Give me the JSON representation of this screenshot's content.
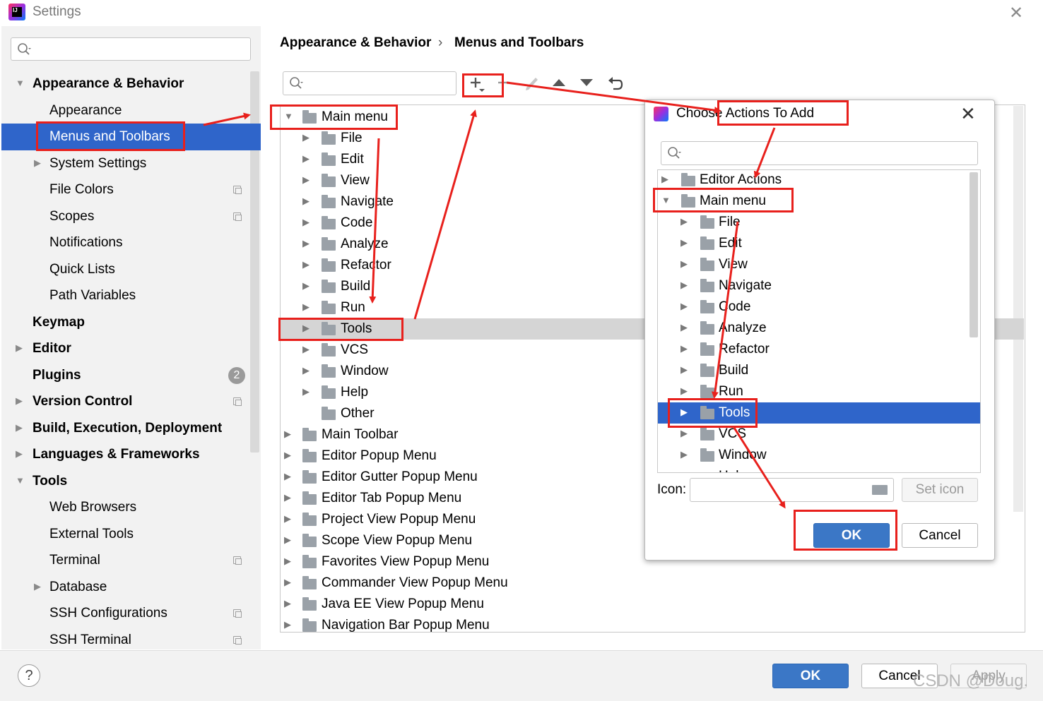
{
  "window": {
    "title": "Settings",
    "close_glyph": "✕",
    "logo_text": "IJ"
  },
  "breadcrumb": {
    "parent": "Appearance & Behavior",
    "separator": "›",
    "current": "Menus and Toolbars"
  },
  "sidebar": {
    "search_placeholder": "",
    "items": [
      {
        "label": "Appearance & Behavior"
      },
      {
        "label": "Appearance"
      },
      {
        "label": "Menus and Toolbars"
      },
      {
        "label": "System Settings"
      },
      {
        "label": "File Colors"
      },
      {
        "label": "Scopes"
      },
      {
        "label": "Notifications"
      },
      {
        "label": "Quick Lists"
      },
      {
        "label": "Path Variables"
      },
      {
        "label": "Keymap"
      },
      {
        "label": "Editor"
      },
      {
        "label": "Plugins"
      },
      {
        "label": "Version Control"
      },
      {
        "label": "Build, Execution, Deployment"
      },
      {
        "label": "Languages & Frameworks"
      },
      {
        "label": "Tools"
      },
      {
        "label": "Web Browsers"
      },
      {
        "label": "External Tools"
      },
      {
        "label": "Terminal"
      },
      {
        "label": "Database"
      },
      {
        "label": "SSH Configurations"
      },
      {
        "label": "SSH Terminal"
      }
    ],
    "plugins_badge": "2"
  },
  "toolbar": {
    "icons": [
      "add-icon",
      "remove-icon",
      "edit-icon",
      "move-up-icon",
      "move-down-icon",
      "restore-icon"
    ]
  },
  "main_tree": {
    "rows": [
      {
        "label": "Main menu"
      },
      {
        "label": "File"
      },
      {
        "label": "Edit"
      },
      {
        "label": "View"
      },
      {
        "label": "Navigate"
      },
      {
        "label": "Code"
      },
      {
        "label": "Analyze"
      },
      {
        "label": "Refactor"
      },
      {
        "label": "Build"
      },
      {
        "label": "Run"
      },
      {
        "label": "Tools"
      },
      {
        "label": "VCS"
      },
      {
        "label": "Window"
      },
      {
        "label": "Help"
      },
      {
        "label": "Other"
      },
      {
        "label": "Main Toolbar"
      },
      {
        "label": "Editor Popup Menu"
      },
      {
        "label": "Editor Gutter Popup Menu"
      },
      {
        "label": "Editor Tab Popup Menu"
      },
      {
        "label": "Project View Popup Menu"
      },
      {
        "label": "Scope View Popup Menu"
      },
      {
        "label": "Favorites View Popup Menu"
      },
      {
        "label": "Commander View Popup Menu"
      },
      {
        "label": "Java EE View Popup Menu"
      },
      {
        "label": "Navigation Bar Popup Menu"
      }
    ]
  },
  "dialog": {
    "title": "Choose Actions To Add",
    "close_glyph": "✕",
    "search_placeholder": "",
    "tree_rows": [
      {
        "label": "Editor Actions"
      },
      {
        "label": "Main menu"
      },
      {
        "label": "File"
      },
      {
        "label": "Edit"
      },
      {
        "label": "View"
      },
      {
        "label": "Navigate"
      },
      {
        "label": "Code"
      },
      {
        "label": "Analyze"
      },
      {
        "label": "Refactor"
      },
      {
        "label": "Build"
      },
      {
        "label": "Run"
      },
      {
        "label": "Tools"
      },
      {
        "label": "VCS"
      },
      {
        "label": "Window"
      },
      {
        "label": "Help"
      }
    ],
    "icon_label": "Icon:",
    "icon_value": "",
    "set_icon_label": "Set icon",
    "ok_label": "OK",
    "cancel_label": "Cancel"
  },
  "footer": {
    "help_glyph": "?",
    "ok_label": "OK",
    "cancel_label": "Cancel",
    "apply_label": "Apply"
  },
  "watermark": "CSDN @Doug.",
  "colors": {
    "selection": "#2f65ca",
    "highlight_red": "#e8201c",
    "primary_button": "#3b77c6"
  }
}
